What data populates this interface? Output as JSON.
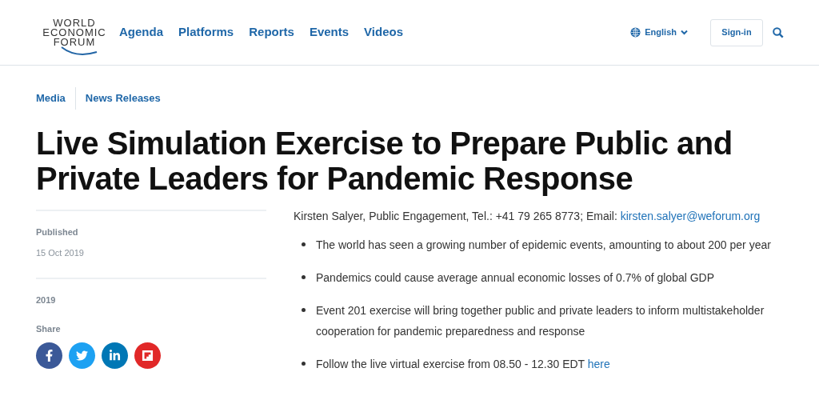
{
  "logo": {
    "lines": [
      "WORLD",
      "ECONOMIC",
      "FORUM"
    ]
  },
  "nav": [
    "Agenda",
    "Platforms",
    "Reports",
    "Events",
    "Videos"
  ],
  "language": "English",
  "sign_in": "Sign-in",
  "breadcrumbs": [
    "Media",
    "News Releases"
  ],
  "title": "Live Simulation Exercise to Prepare Public and Private Leaders for Pandemic Response",
  "sidebar": {
    "published_label": "Published",
    "published_date": "15 Oct 2019",
    "year": "2019",
    "share_label": "Share",
    "share": [
      {
        "kind": "facebook",
        "color": "#3b5998"
      },
      {
        "kind": "twitter",
        "color": "#1da1f2"
      },
      {
        "kind": "linkedin",
        "color": "#0077b5"
      },
      {
        "kind": "flipboard",
        "color": "#e12828"
      }
    ]
  },
  "contact": {
    "text": "Kirsten Salyer, Public Engagement, Tel.: +41 79 265 8773; Email: ",
    "link": "kirsten.salyer@weforum.org"
  },
  "bullets": [
    {
      "text": "The world has seen a growing number of epidemic events, amounting to about 200 per year"
    },
    {
      "text": "Pandemics could cause average annual economic losses of 0.7% of global GDP"
    },
    {
      "text": "Event 201 exercise will bring together public and private leaders to inform multistakeholder cooperation for pandemic preparedness and response"
    },
    {
      "text": "Follow the live virtual exercise from 08.50 - 12.30 EDT ",
      "link": "here"
    }
  ]
}
